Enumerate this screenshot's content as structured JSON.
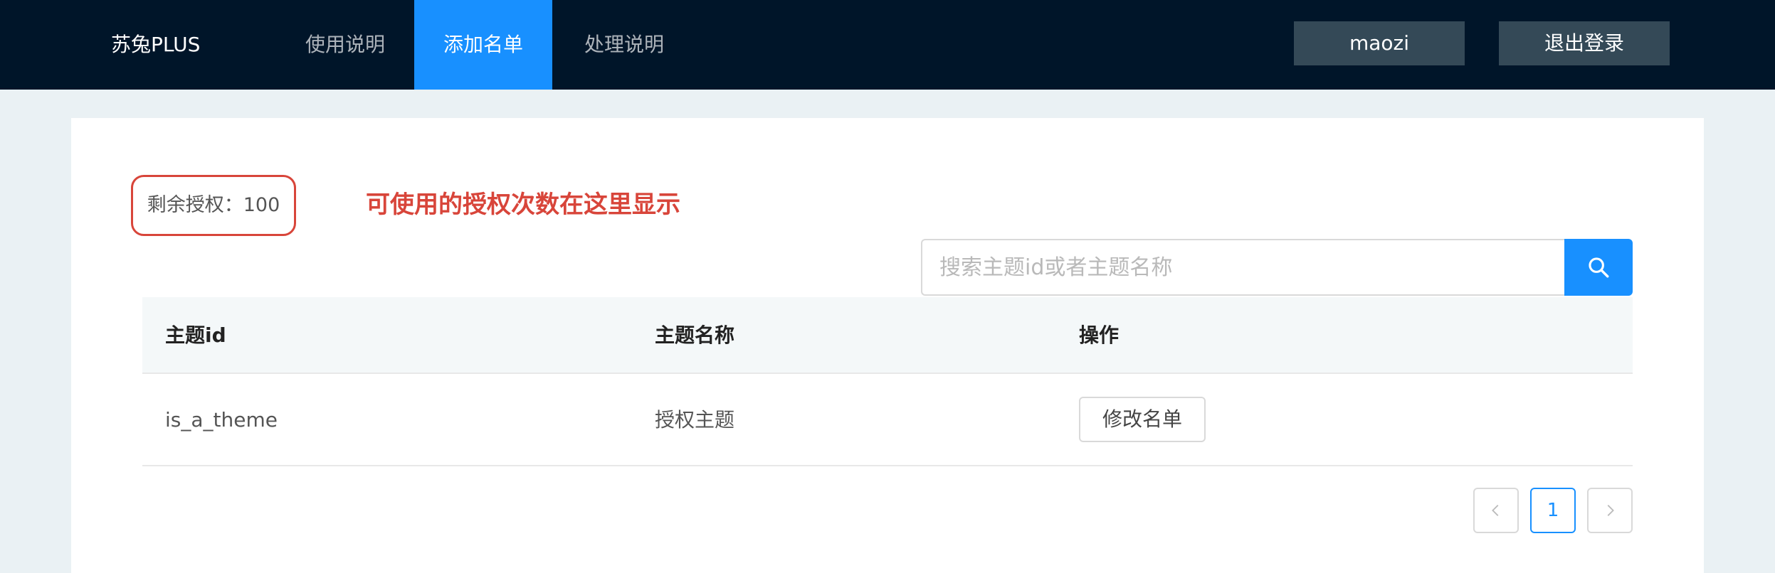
{
  "header": {
    "brand": "苏兔PLUS",
    "nav": [
      {
        "label": "使用说明",
        "active": false
      },
      {
        "label": "添加名单",
        "active": true
      },
      {
        "label": "处理说明",
        "active": false
      }
    ],
    "user_label": "maozi",
    "logout_label": "退出登录"
  },
  "main": {
    "quota": {
      "label": "剩余授权：",
      "value": "100"
    },
    "annotation": "可使用的授权次数在这里显示",
    "search": {
      "placeholder": "搜索主题id或者主题名称",
      "value": "",
      "icon": "search-icon"
    },
    "table": {
      "columns": [
        "主题id",
        "主题名称",
        "操作"
      ],
      "rows": [
        {
          "id": "is_a_theme",
          "name": "授权主题",
          "action_label": "修改名单"
        }
      ]
    },
    "pagination": {
      "current": "1",
      "prev_icon": "chevron-left-icon",
      "next_icon": "chevron-right-icon"
    }
  },
  "colors": {
    "header_bg": "#001529",
    "accent": "#1890ff",
    "annotation": "#d8453a",
    "page_bg": "#eaf1f4",
    "header_button_bg": "#344957"
  }
}
